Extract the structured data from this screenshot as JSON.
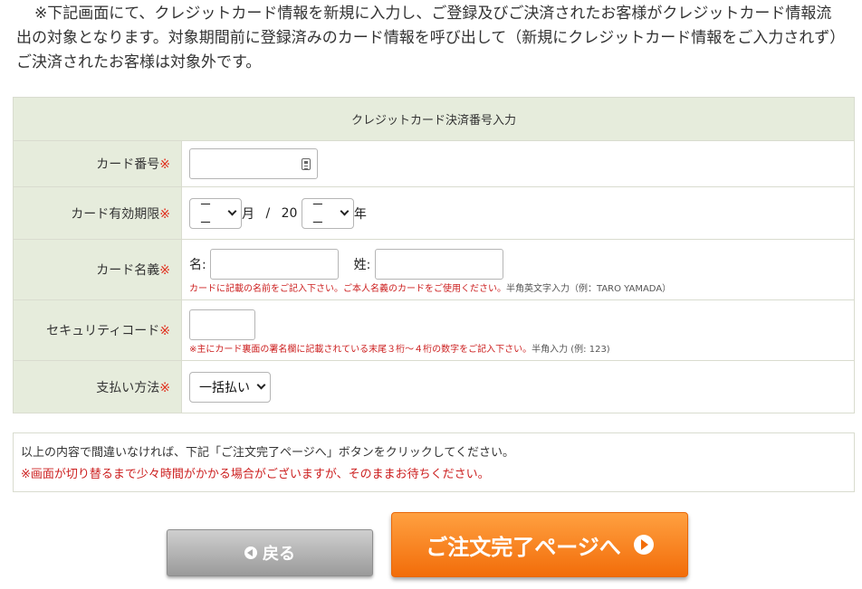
{
  "notice": "※下記画面にて、クレジットカード情報を新規に入力し、ご登録及びご決済されたお客様がクレジットカード情報流出の対象となります。対象期間前に登録済みのカード情報を呼び出して（新規にクレジットカード情報をご入力されず）ご決済されたお客様は対象外です。",
  "form": {
    "title": "クレジットカード決済番号入力",
    "required_mark": "※",
    "card_number": {
      "label": "カード番号",
      "value": ""
    },
    "expiry": {
      "label": "カード有効期限",
      "month_value": "－－",
      "month_suffix": "月",
      "separator": "/",
      "year_prefix": "20",
      "year_value": "－－",
      "year_suffix": "年"
    },
    "card_name": {
      "label": "カード名義",
      "first_label": "名:",
      "last_label": "姓:",
      "first_value": "",
      "last_value": "",
      "hint_red": "カードに記載の名前をご記入下さい。ご本人名義のカードをご使用ください。",
      "hint_plain": "半角英文字入力（例：TARO YAMADA）"
    },
    "security_code": {
      "label": "セキュリティコード",
      "value": "",
      "hint_red": "※主にカード裏面の署名欄に記載されている末尾３桁～４桁の数字をご記入下さい。",
      "hint_plain": "半角入力 (例: 123)"
    },
    "payment_method": {
      "label": "支払い方法",
      "value": "一括払い"
    }
  },
  "confirm": {
    "line1": "以上の内容で間違いなければ、下記「ご注文完了ページへ」ボタンをクリックしてください。",
    "line2": "※画面が切り替るまで少々時間がかかる場合がございますが、そのままお待ちください。"
  },
  "buttons": {
    "back_label": "戻る",
    "next_label": "ご注文完了ページへ"
  },
  "colors": {
    "header_bg": "#e6ecdc",
    "required": "#e0301e",
    "next_button": "#f26d0a",
    "back_button": "#9a9a9a"
  },
  "icons": [
    "card-icon",
    "chevron-down-icon",
    "arrow-left-circle-icon",
    "arrow-right-circle-icon"
  ]
}
